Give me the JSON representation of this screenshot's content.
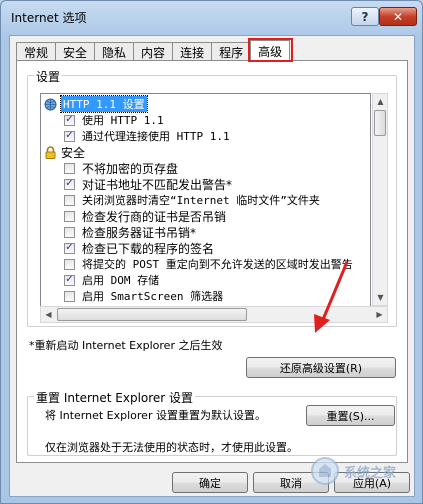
{
  "window": {
    "title": "Internet 选项",
    "help_label": "?",
    "close_label": "✕"
  },
  "tabs": [
    {
      "label": "常规"
    },
    {
      "label": "安全"
    },
    {
      "label": "隐私"
    },
    {
      "label": "内容"
    },
    {
      "label": "连接"
    },
    {
      "label": "程序"
    },
    {
      "label": "高级"
    }
  ],
  "active_tab": "高级",
  "settings_group": {
    "label": "设置",
    "items": [
      {
        "type": "header",
        "icon": "globe-icon",
        "text": "HTTP 1.1 设置",
        "selected": true
      },
      {
        "type": "check",
        "checked": true,
        "text": "使用 HTTP 1.1"
      },
      {
        "type": "check",
        "checked": true,
        "text": "通过代理连接使用 HTTP 1.1"
      },
      {
        "type": "header",
        "icon": "lock-icon",
        "text": "安全",
        "selected": false
      },
      {
        "type": "check",
        "checked": false,
        "text": "不将加密的页存盘"
      },
      {
        "type": "check",
        "checked": true,
        "text": "对证书地址不匹配发出警告*"
      },
      {
        "type": "check",
        "checked": false,
        "text": "关闭浏览器时清空“Internet 临时文件”文件夹"
      },
      {
        "type": "check",
        "checked": false,
        "text": "检查发行商的证书是否吊销"
      },
      {
        "type": "check",
        "checked": false,
        "text": "检查服务器证书吊销*"
      },
      {
        "type": "check",
        "checked": true,
        "text": "检查已下载的程序的签名"
      },
      {
        "type": "check",
        "checked": false,
        "text": "将提交的 POST 重定向到不允许发送的区域时发出警告"
      },
      {
        "type": "check",
        "checked": true,
        "text": "启用 DOM 存储"
      },
      {
        "type": "check",
        "checked": false,
        "text": "启用 SmartScreen 筛选器"
      }
    ]
  },
  "restart_note": "*重新启动 Internet Explorer 之后生效",
  "restore_advanced_label": "还原高级设置(R)",
  "reset_group": {
    "label": "重置 Internet Explorer 设置",
    "description": "将 Internet Explorer 设置重置为默认设置。",
    "reset_label": "重置(S)...",
    "footer": "仅在浏览器处于无法使用的状态时，才使用此设置。"
  },
  "footer": {
    "ok_label": "确定",
    "cancel_label": "取消",
    "apply_label": "应用(A)"
  },
  "watermark": {
    "text": "系统之家"
  },
  "colors": {
    "highlight": "#3399ff",
    "annotation": "#e02020"
  }
}
